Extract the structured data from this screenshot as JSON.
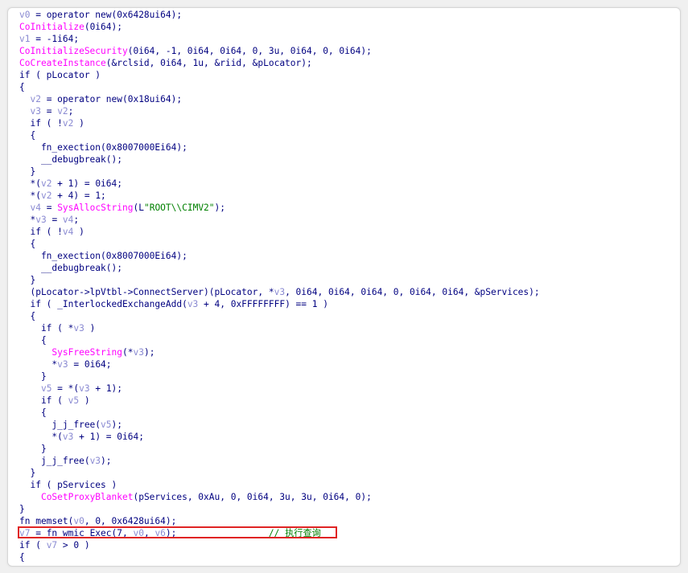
{
  "colors": {
    "keyword_text": "#0d0d80",
    "variable": "#8a8ad2",
    "function": "#ff00ff",
    "string": "#008000",
    "comment": "#008000",
    "highlight_border": "#e02424"
  },
  "code_lines": [
    [
      {
        "t": "v0",
        "c": "var"
      },
      {
        "t": " = operator new(0x6428ui64);",
        "c": "txt"
      }
    ],
    [
      {
        "t": "CoInitialize",
        "c": "fn"
      },
      {
        "t": "(0i64);",
        "c": "txt"
      }
    ],
    [
      {
        "t": "v1",
        "c": "var"
      },
      {
        "t": " = -1i64;",
        "c": "txt"
      }
    ],
    [
      {
        "t": "CoInitializeSecurity",
        "c": "fn"
      },
      {
        "t": "(0i64, -1, 0i64, 0i64, 0, 3u, 0i64, 0, 0i64);",
        "c": "txt"
      }
    ],
    [
      {
        "t": "CoCreateInstance",
        "c": "fn"
      },
      {
        "t": "(&rclsid, 0i64, 1u, &riid, &pLocator);",
        "c": "txt"
      }
    ],
    [
      {
        "t": "if ( pLocator )",
        "c": "txt"
      }
    ],
    [
      {
        "t": "{",
        "c": "txt"
      }
    ],
    [
      {
        "t": "  ",
        "c": "txt"
      },
      {
        "t": "v2",
        "c": "var"
      },
      {
        "t": " = operator new(0x18ui64);",
        "c": "txt"
      }
    ],
    [
      {
        "t": "  ",
        "c": "txt"
      },
      {
        "t": "v3",
        "c": "var"
      },
      {
        "t": " = ",
        "c": "txt"
      },
      {
        "t": "v2",
        "c": "var"
      },
      {
        "t": ";",
        "c": "txt"
      }
    ],
    [
      {
        "t": "  if ( !",
        "c": "txt"
      },
      {
        "t": "v2",
        "c": "var"
      },
      {
        "t": " )",
        "c": "txt"
      }
    ],
    [
      {
        "t": "  {",
        "c": "txt"
      }
    ],
    [
      {
        "t": "    fn_exection(0x8007000Ei64);",
        "c": "txt"
      }
    ],
    [
      {
        "t": "    __debugbreak();",
        "c": "txt"
      }
    ],
    [
      {
        "t": "  }",
        "c": "txt"
      }
    ],
    [
      {
        "t": "  *(",
        "c": "txt"
      },
      {
        "t": "v2",
        "c": "var"
      },
      {
        "t": " + 1) = 0i64;",
        "c": "txt"
      }
    ],
    [
      {
        "t": "  *(",
        "c": "txt"
      },
      {
        "t": "v2",
        "c": "var"
      },
      {
        "t": " + 4) = 1;",
        "c": "txt"
      }
    ],
    [
      {
        "t": "  ",
        "c": "txt"
      },
      {
        "t": "v4",
        "c": "var"
      },
      {
        "t": " = ",
        "c": "txt"
      },
      {
        "t": "SysAllocString",
        "c": "fn"
      },
      {
        "t": "(L",
        "c": "txt"
      },
      {
        "t": "\"ROOT\\\\CIMV2\"",
        "c": "str"
      },
      {
        "t": ");",
        "c": "txt"
      }
    ],
    [
      {
        "t": "  *",
        "c": "txt"
      },
      {
        "t": "v3",
        "c": "var"
      },
      {
        "t": " = ",
        "c": "txt"
      },
      {
        "t": "v4",
        "c": "var"
      },
      {
        "t": ";",
        "c": "txt"
      }
    ],
    [
      {
        "t": "  if ( !",
        "c": "txt"
      },
      {
        "t": "v4",
        "c": "var"
      },
      {
        "t": " )",
        "c": "txt"
      }
    ],
    [
      {
        "t": "  {",
        "c": "txt"
      }
    ],
    [
      {
        "t": "    fn_exection(0x8007000Ei64);",
        "c": "txt"
      }
    ],
    [
      {
        "t": "    __debugbreak();",
        "c": "txt"
      }
    ],
    [
      {
        "t": "  }",
        "c": "txt"
      }
    ],
    [
      {
        "t": "  (pLocator->lpVtbl->ConnectServer)(pLocator, *",
        "c": "txt"
      },
      {
        "t": "v3",
        "c": "var"
      },
      {
        "t": ", 0i64, 0i64, 0i64, 0, 0i64, 0i64, &pServices);",
        "c": "txt"
      }
    ],
    [
      {
        "t": "  if ( _InterlockedExchangeAdd(",
        "c": "txt"
      },
      {
        "t": "v3",
        "c": "var"
      },
      {
        "t": " + 4, 0xFFFFFFFF) == 1 )",
        "c": "txt"
      }
    ],
    [
      {
        "t": "  {",
        "c": "txt"
      }
    ],
    [
      {
        "t": "    if ( *",
        "c": "txt"
      },
      {
        "t": "v3",
        "c": "var"
      },
      {
        "t": " )",
        "c": "txt"
      }
    ],
    [
      {
        "t": "    {",
        "c": "txt"
      }
    ],
    [
      {
        "t": "      ",
        "c": "txt"
      },
      {
        "t": "SysFreeString",
        "c": "fn"
      },
      {
        "t": "(*",
        "c": "txt"
      },
      {
        "t": "v3",
        "c": "var"
      },
      {
        "t": ");",
        "c": "txt"
      }
    ],
    [
      {
        "t": "      *",
        "c": "txt"
      },
      {
        "t": "v3",
        "c": "var"
      },
      {
        "t": " = 0i64;",
        "c": "txt"
      }
    ],
    [
      {
        "t": "    }",
        "c": "txt"
      }
    ],
    [
      {
        "t": "    ",
        "c": "txt"
      },
      {
        "t": "v5",
        "c": "var"
      },
      {
        "t": " = *(",
        "c": "txt"
      },
      {
        "t": "v3",
        "c": "var"
      },
      {
        "t": " + 1);",
        "c": "txt"
      }
    ],
    [
      {
        "t": "    if ( ",
        "c": "txt"
      },
      {
        "t": "v5",
        "c": "var"
      },
      {
        "t": " )",
        "c": "txt"
      }
    ],
    [
      {
        "t": "    {",
        "c": "txt"
      }
    ],
    [
      {
        "t": "      j_j_free(",
        "c": "txt"
      },
      {
        "t": "v5",
        "c": "var"
      },
      {
        "t": ");",
        "c": "txt"
      }
    ],
    [
      {
        "t": "      *(",
        "c": "txt"
      },
      {
        "t": "v3",
        "c": "var"
      },
      {
        "t": " + 1) = 0i64;",
        "c": "txt"
      }
    ],
    [
      {
        "t": "    }",
        "c": "txt"
      }
    ],
    [
      {
        "t": "    j_j_free(",
        "c": "txt"
      },
      {
        "t": "v3",
        "c": "var"
      },
      {
        "t": ");",
        "c": "txt"
      }
    ],
    [
      {
        "t": "  }",
        "c": "txt"
      }
    ],
    [
      {
        "t": "  if ( pServices )",
        "c": "txt"
      }
    ],
    [
      {
        "t": "    ",
        "c": "txt"
      },
      {
        "t": "CoSetProxyBlanket",
        "c": "fn"
      },
      {
        "t": "(pServices, 0xAu, 0, 0i64, 3u, 3u, 0i64, 0);",
        "c": "txt"
      }
    ],
    [
      {
        "t": "}",
        "c": "txt"
      }
    ],
    [
      {
        "t": "fn memset(",
        "c": "txt"
      },
      {
        "t": "v0",
        "c": "var"
      },
      {
        "t": ", 0, 0x6428ui64);",
        "c": "txt"
      }
    ],
    [
      {
        "t": "v7",
        "c": "var"
      },
      {
        "t": " = fn_wmic_Exec(7, ",
        "c": "txt"
      },
      {
        "t": "v0",
        "c": "var"
      },
      {
        "t": ", ",
        "c": "txt"
      },
      {
        "t": "v6",
        "c": "var"
      },
      {
        "t": ");",
        "c": "txt"
      },
      {
        "t": "                 // 执行查询",
        "c": "cmt"
      }
    ],
    [
      {
        "t": "if ( ",
        "c": "txt"
      },
      {
        "t": "v7",
        "c": "var"
      },
      {
        "t": " > 0 )",
        "c": "txt"
      }
    ],
    [
      {
        "t": "{",
        "c": "txt"
      }
    ]
  ],
  "highlighted_line_index": 43
}
